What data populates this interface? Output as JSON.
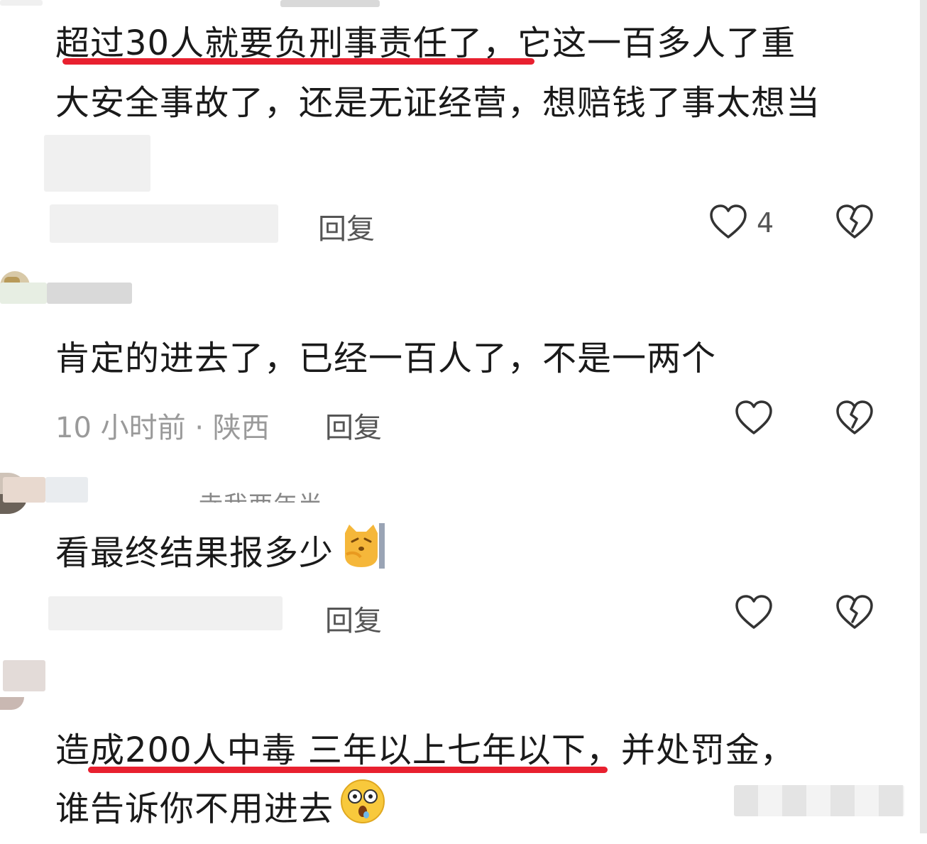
{
  "comments": [
    {
      "line1_underlined": "超过30人就要负刑事责任了，",
      "line1_rest": "它这一百多人了重",
      "line2": "大安全事故了，还是无证经营，想赔钱了事太想当",
      "reply_label": "回复",
      "like_count": "4"
    },
    {
      "text": "肯定的进去了，已经一百人了，不是一两个",
      "meta": "10 小时前 · 陕西",
      "reply_label": "回复"
    },
    {
      "quoted_snippet": "寺我两年半。",
      "text": "看最终结果报多少",
      "emoji": "cat-emoji",
      "reply_label": "回复"
    },
    {
      "line1_pre": "造",
      "line1_underlined": "成200人中毒 三年以上七年以下",
      "line1_post": "，并处罚金，",
      "line2": "谁告诉你不用进去",
      "emoji": "shocked-face-emoji"
    }
  ],
  "colors": {
    "underline": "#e8202f",
    "text": "#1a1a1a",
    "meta": "#9a9a9a"
  },
  "icons": [
    "heart-icon",
    "broken-heart-icon"
  ]
}
